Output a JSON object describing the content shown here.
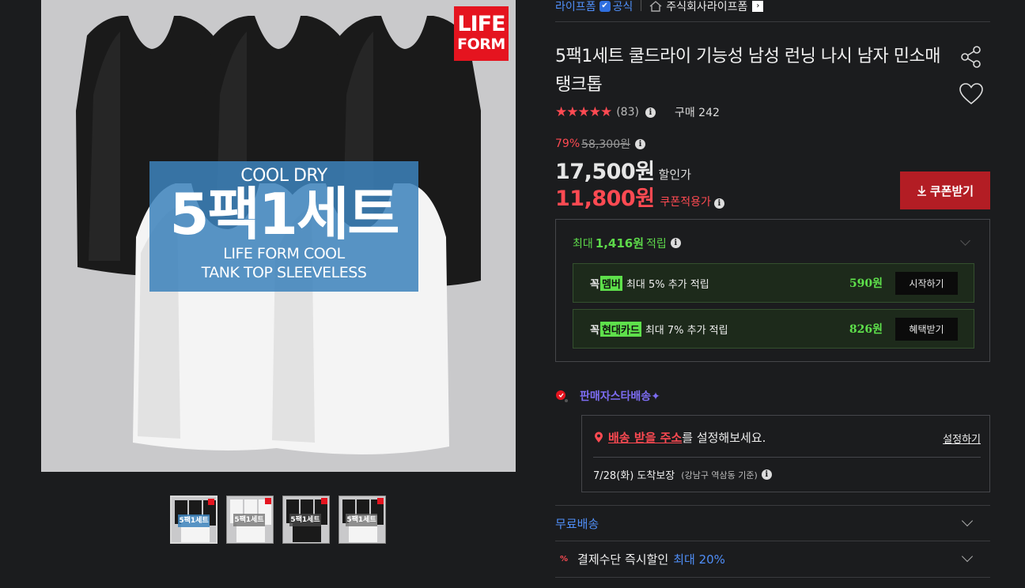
{
  "image": {
    "logo_line1": "LIFE",
    "logo_line2": "FORM",
    "banner_line1": "COOL DRY",
    "banner_line2": "5팩1세트",
    "banner_line3": "LIFE FORM COOL",
    "banner_line4": "TANK TOP SLEEVELESS",
    "thumbnails": [
      {
        "tag": "5팩1세트",
        "active": true
      },
      {
        "tag": "5팩1세트",
        "active": false
      },
      {
        "tag": "5팩1세트",
        "active": false
      },
      {
        "tag": "5팩1세트",
        "active": false
      }
    ]
  },
  "brandbar": {
    "brand": "라이프폼",
    "official": "공식",
    "store": "주식회사라이프폼"
  },
  "product": {
    "title": "5팩1세트 쿨드라이 기능성 남성 런닝 나시 남자 민소매 탱크톱",
    "stars": "★★★★★",
    "review_count": "(83)",
    "purchase": "구매 242",
    "discount_pct": "79%",
    "original_price": "58,300원",
    "sale_price": "17,500원",
    "sale_label": "할인가",
    "coupon_price": "11,800원",
    "coupon_label": "쿠폰적용가",
    "coupon_button": "쿠폰받기"
  },
  "points": {
    "prefix": "최대",
    "amount": "1,416원",
    "suffix": "적립",
    "rows": [
      {
        "kk": "꼭",
        "badge": "멤버",
        "desc": "최대 5% 추가 적립",
        "amount": "590원",
        "button": "시작하기"
      },
      {
        "kk": "꼭",
        "badge": "현대카드",
        "desc": "최대 7% 추가 적립",
        "amount": "826원",
        "button": "혜택받기"
      }
    ]
  },
  "delivery": {
    "star_label": "판매자스타배송✦",
    "address_link": "배송 받을 주소",
    "address_suffix": "를 설정해보세요.",
    "set_link": "설정하기",
    "eta": "7/28(화) 도착보장",
    "eta_note": "(강남구 역삼동 기준)"
  },
  "accordion": {
    "free_shipping": "무료배송",
    "payment_label": "결제수단 즉시할인",
    "payment_highlight": "최대 20%"
  },
  "colors": {
    "accent_red": "#ff4a52",
    "coupon_button": "#b31d24",
    "points_green": "#5ee04b",
    "link_blue": "#4f8ef7",
    "star_delivery": "#7c6cf2"
  }
}
